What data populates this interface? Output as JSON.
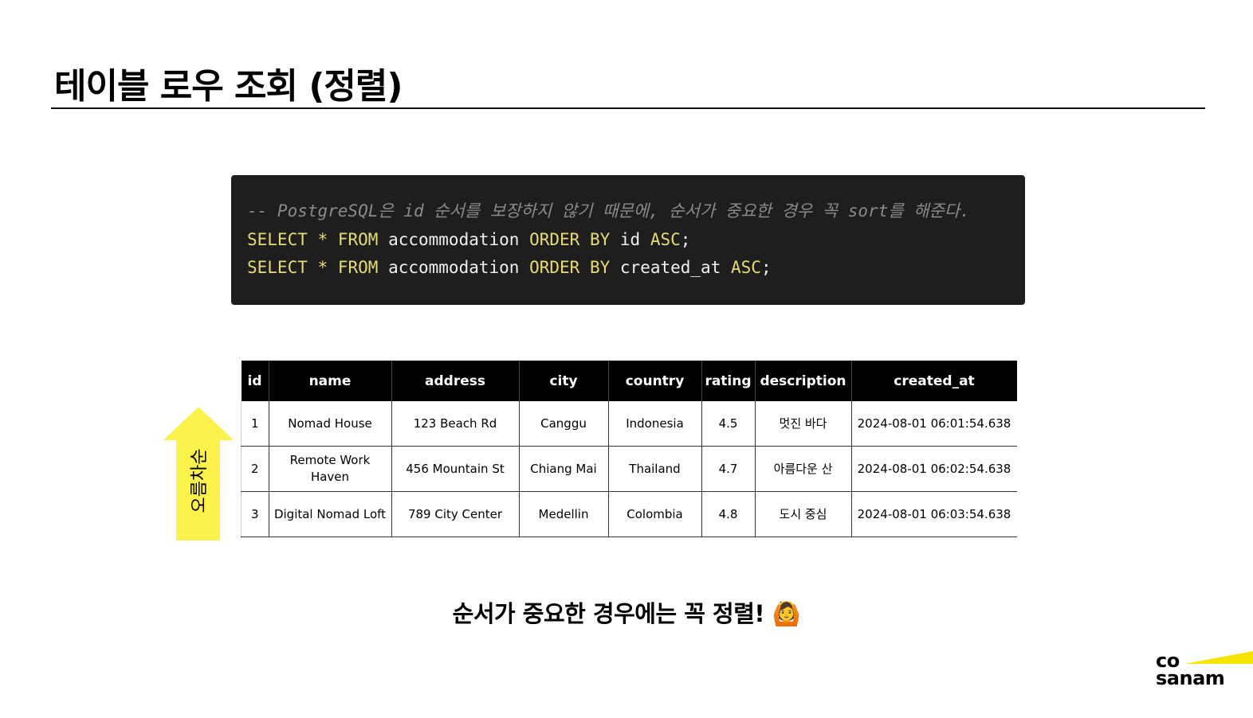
{
  "page": {
    "title": "테이블 로우 조회 (정렬)",
    "tagline": "순서가 중요한 경우에는 꼭 정렬!",
    "tagline_emoji": "🙆"
  },
  "code": {
    "comment": "-- PostgreSQL은 id 순서를 보장하지 않기 때문에, 순서가 중요한 경우 꼭 sort를 해준다.",
    "lines": [
      {
        "select": "SELECT",
        "star": "*",
        "from": "FROM",
        "table": "accommodation",
        "order": "ORDER BY",
        "col": "id",
        "dir": "ASC",
        "end": ";"
      },
      {
        "select": "SELECT",
        "star": "*",
        "from": "FROM",
        "table": "accommodation",
        "order": "ORDER BY",
        "col": "created_at",
        "dir": "ASC",
        "end": ";"
      }
    ]
  },
  "sort_indicator": {
    "label": "오름차순",
    "color": "#FDF14B"
  },
  "table": {
    "columns": [
      "id",
      "name",
      "address",
      "city",
      "country",
      "rating",
      "description",
      "created_at"
    ],
    "rows": [
      [
        "1",
        "Nomad House",
        "123 Beach Rd",
        "Canggu",
        "Indonesia",
        "4.5",
        "멋진 바다",
        "2024-08-01 06:01:54.638"
      ],
      [
        "2",
        "Remote Work Haven",
        "456 Mountain St",
        "Chiang Mai",
        "Thailand",
        "4.7",
        "아름다운 산",
        "2024-08-01 06:02:54.638"
      ],
      [
        "3",
        "Digital Nomad Loft",
        "789 City Center",
        "Medellin",
        "Colombia",
        "4.8",
        "도시 중심",
        "2024-08-01 06:03:54.638"
      ]
    ]
  },
  "logo": {
    "line1": "co",
    "line2": "sanam",
    "accent": "#F5E400"
  }
}
